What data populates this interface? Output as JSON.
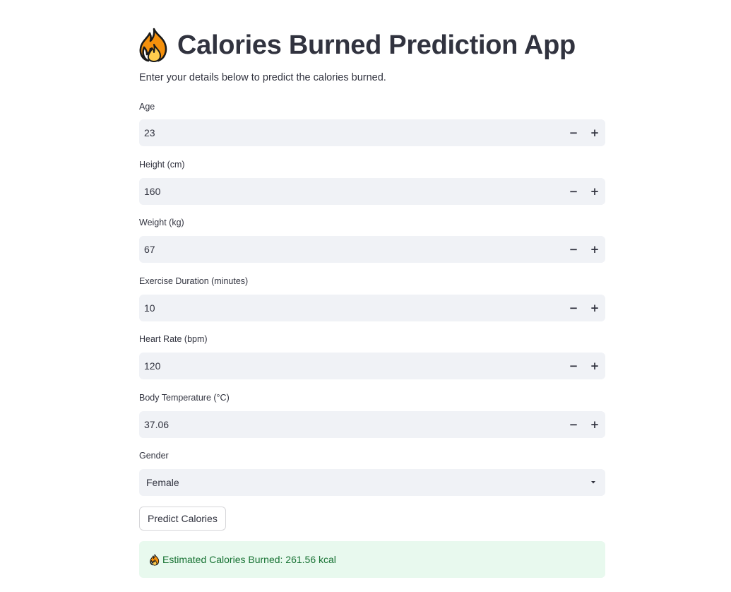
{
  "header": {
    "title": "Calories Burned Prediction App",
    "title_icon": "fire-icon",
    "intro": "Enter your details below to predict the calories burned."
  },
  "form": {
    "fields": [
      {
        "label": "Age",
        "value": "23"
      },
      {
        "label": "Height (cm)",
        "value": "160"
      },
      {
        "label": "Weight (kg)",
        "value": "67"
      },
      {
        "label": "Exercise Duration (minutes)",
        "value": "10"
      },
      {
        "label": "Heart Rate (bpm)",
        "value": "120"
      },
      {
        "label": "Body Temperature (°C)",
        "value": "37.06"
      }
    ],
    "decrement_symbol": "−",
    "increment_symbol": "+",
    "gender": {
      "label": "Gender",
      "value": "Female"
    },
    "predict_label": "Predict Calories"
  },
  "result": {
    "icon": "fire-icon",
    "text": "Estimated Calories Burned: 261.56 kcal"
  },
  "colors": {
    "text": "#31333F",
    "input_bg": "#F0F2F6",
    "success_bg": "#E8F9EE",
    "success_text": "#177233"
  }
}
